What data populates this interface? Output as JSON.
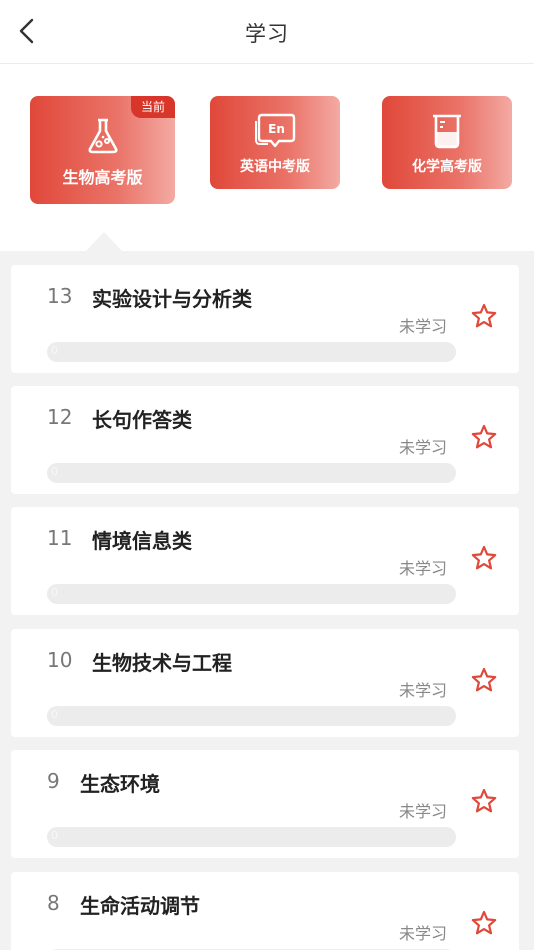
{
  "header": {
    "title": "学习",
    "back_icon": "chevron-left-icon"
  },
  "books": [
    {
      "label": "生物高考版",
      "icon": "flask-icon",
      "badge": "当前",
      "current": true
    },
    {
      "label": "英语中考版",
      "icon": "en-book-icon",
      "icon_text": "En",
      "current": false
    },
    {
      "label": "化学高考版",
      "icon": "beaker-icon",
      "current": false
    }
  ],
  "chapters": [
    {
      "num": "13",
      "name": "实验设计与分析类",
      "status": "未学习",
      "progress": 0,
      "progress_label": "0"
    },
    {
      "num": "12",
      "name": "长句作答类",
      "status": "未学习",
      "progress": 0,
      "progress_label": "0"
    },
    {
      "num": "11",
      "name": "情境信息类",
      "status": "未学习",
      "progress": 0,
      "progress_label": "0"
    },
    {
      "num": "10",
      "name": "生物技术与工程",
      "status": "未学习",
      "progress": 0,
      "progress_label": "0"
    },
    {
      "num": "9",
      "name": "生态环境",
      "status": "未学习",
      "progress": 0,
      "progress_label": "0"
    },
    {
      "num": "8",
      "name": "生命活动调节",
      "status": "未学习",
      "progress": 0,
      "progress_label": "0"
    }
  ],
  "colors": {
    "accent": "#e0483a",
    "star": "#e0483a",
    "list_bg": "#f2f2f2"
  }
}
